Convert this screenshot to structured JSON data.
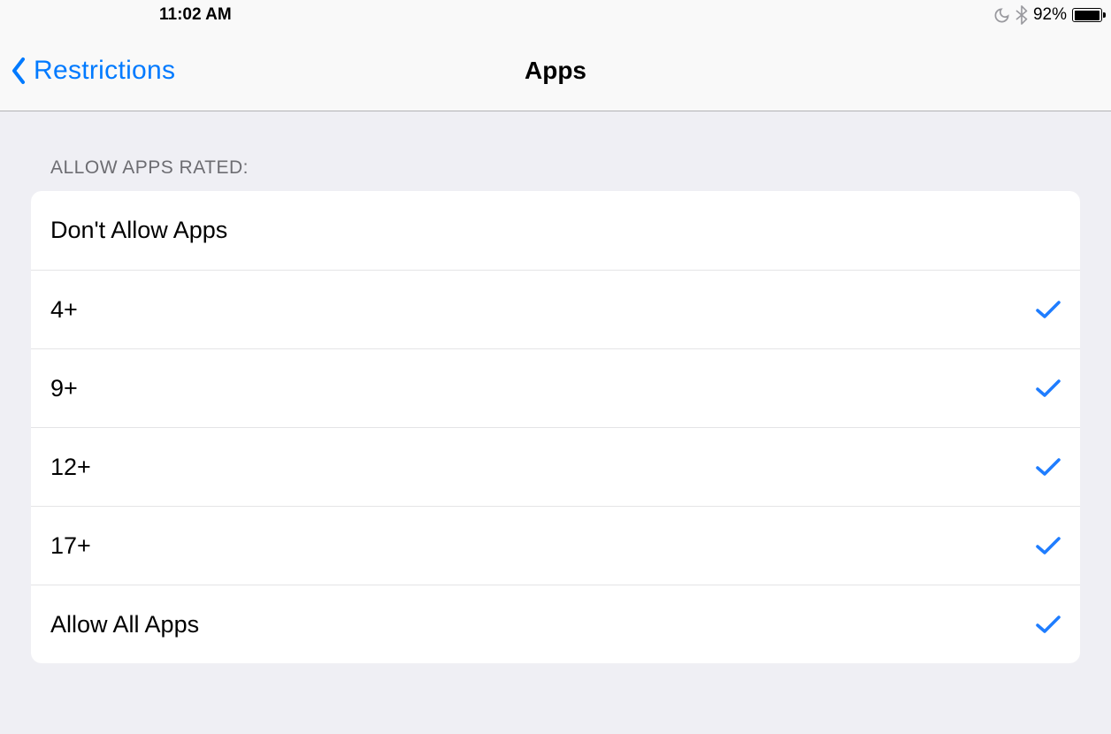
{
  "status": {
    "time": "11:02 AM",
    "battery": "92%"
  },
  "nav": {
    "back": "Restrictions",
    "title": "Apps"
  },
  "section": {
    "header": "ALLOW APPS RATED:"
  },
  "rows": [
    {
      "label": "Don't Allow Apps",
      "checked": false
    },
    {
      "label": "4+",
      "checked": true
    },
    {
      "label": "9+",
      "checked": true
    },
    {
      "label": "12+",
      "checked": true
    },
    {
      "label": "17+",
      "checked": true
    },
    {
      "label": "Allow All Apps",
      "checked": true
    }
  ]
}
